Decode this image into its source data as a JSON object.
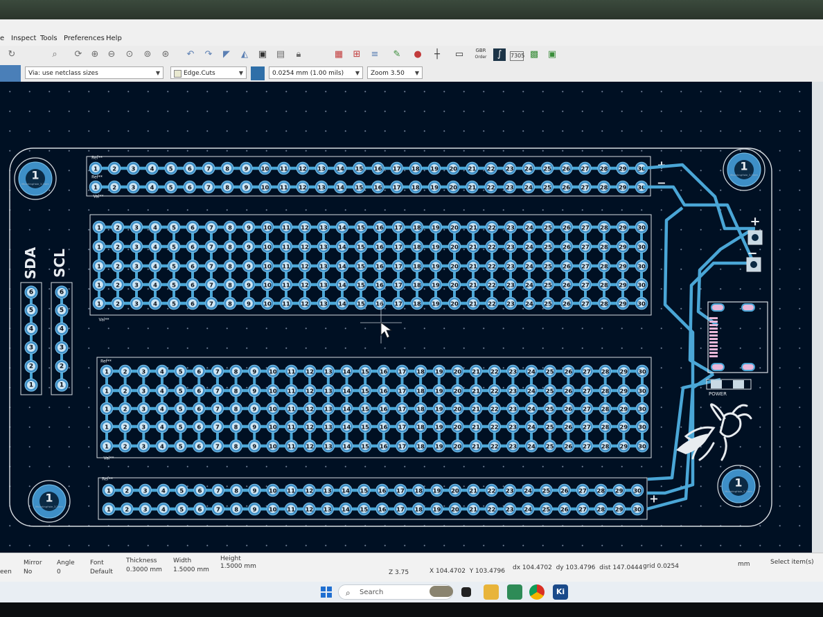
{
  "menu": {
    "file_partial": "e",
    "inspect": "Inspect",
    "tools": "Tools",
    "preferences": "Preferences",
    "help": "Help"
  },
  "toolbar": {
    "gerber_label_top": "GBR",
    "gerber_label_bottom": "Order"
  },
  "options": {
    "via_size": "Via: use netclass sizes",
    "layer": "Edge.Cuts",
    "grid": "0.0254 mm (1.00 mils)",
    "zoom": "Zoom 3.50"
  },
  "pcb": {
    "labels": {
      "sda": "SDA",
      "scl": "SCL",
      "power": "POWER",
      "plus": "+",
      "minus": "−",
      "ref": "Ref**",
      "val": "Val**",
      "mount_hole": "1",
      "mount_hole_text": "MountingHole_3.2mm"
    },
    "column_numbers": [
      "1",
      "2",
      "3",
      "4",
      "5",
      "6",
      "7",
      "8",
      "9",
      "10",
      "11",
      "12",
      "13",
      "14",
      "15",
      "16",
      "17",
      "18",
      "19",
      "20",
      "21",
      "22",
      "23",
      "24",
      "25",
      "26",
      "27",
      "28",
      "29",
      "30"
    ],
    "header_numbers": [
      "6",
      "5",
      "4",
      "3",
      "2",
      "1"
    ],
    "colors": {
      "board": "#001023",
      "trace": "#4aa6d6",
      "pad": "#3e8fc7",
      "pad_text": "#0a0f18",
      "silk": "#e8ecf0",
      "edge": "#d8dde2"
    }
  },
  "status": {
    "left_partial": "een",
    "mirror_label": "Mirror",
    "mirror_value": "No",
    "angle_label": "Angle",
    "angle_value": "0",
    "font_label": "Font",
    "font_value": "Default",
    "thickness_label": "Thickness",
    "thickness_value": "0.3000 mm",
    "width_label": "Width",
    "width_value": "1.5000 mm",
    "height_label": "Height",
    "height_value": "1.5000 mm",
    "zoom": "Z 3.75",
    "coords": "X 104.4702  Y 103.4796",
    "delta": "dx 104.4702  dy 103.4796  dist 147.0444",
    "grid": "grid 0.0254",
    "units": "mm",
    "mode": "Select item(s)"
  },
  "taskbar": {
    "search": "Search",
    "kicad": "Ki"
  }
}
